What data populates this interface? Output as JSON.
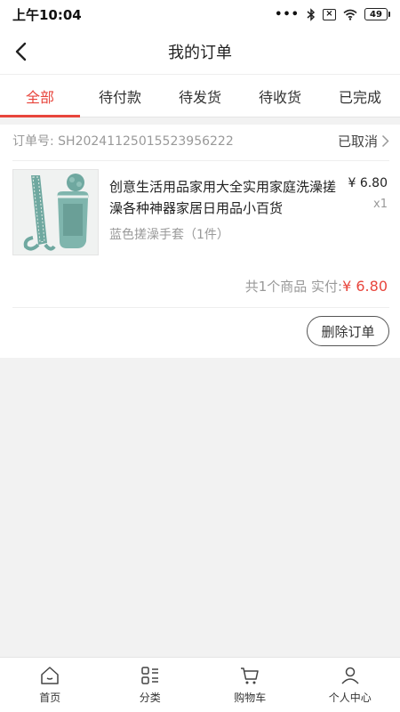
{
  "status_bar": {
    "time": "上午10:04",
    "battery": "49",
    "icons": [
      "signal-dots-icon",
      "bluetooth-icon",
      "sim-blocked-icon",
      "wifi-icon",
      "battery-icon"
    ]
  },
  "navbar": {
    "title": "我的订单",
    "back_icon": "chevron-left-icon"
  },
  "tabs": [
    {
      "label": "全部",
      "active": true
    },
    {
      "label": "待付款",
      "active": false
    },
    {
      "label": "待发货",
      "active": false
    },
    {
      "label": "待收货",
      "active": false
    },
    {
      "label": "已完成",
      "active": false
    }
  ],
  "order": {
    "order_no": "订单号: SH20241125015523956222",
    "status": "已取消",
    "goods": {
      "title": "创意生活用品家用大全实用家庭洗澡搓澡各种神器家居日用品小百货",
      "spec": "蓝色搓澡手套（1件）",
      "price": "¥ 6.80",
      "qty": "x1"
    },
    "summary_prefix": "共1个商品 实付:",
    "total": "¥ 6.80",
    "delete_label": "删除订单"
  },
  "tabbar": [
    {
      "label": "首页",
      "icon": "home-icon"
    },
    {
      "label": "分类",
      "icon": "category-icon"
    },
    {
      "label": "购物车",
      "icon": "cart-icon"
    },
    {
      "label": "个人中心",
      "icon": "user-icon"
    }
  ],
  "colors": {
    "accent": "#e8453c",
    "background": "#f2f2f2",
    "product_teal": "#6fa8a0"
  }
}
